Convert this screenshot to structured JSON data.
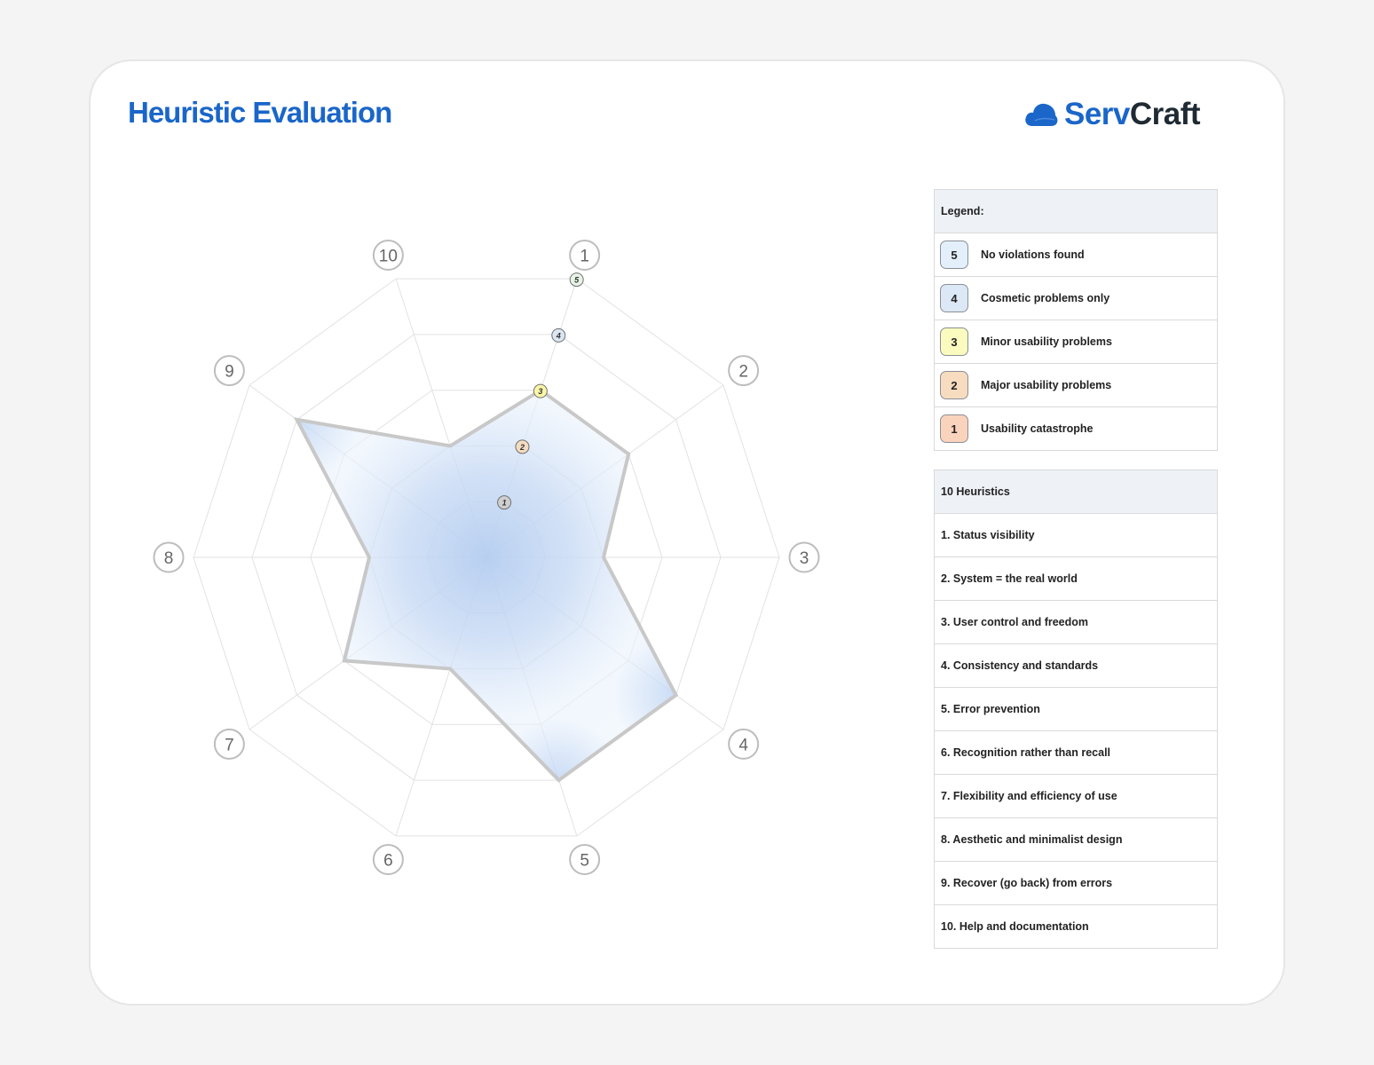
{
  "header": {
    "title": "Heuristic Evaluation",
    "brand_part1": "Serv",
    "brand_part2": "Craft",
    "brand_colors": {
      "accent": "#1a66c9",
      "dark": "#1f2a33"
    }
  },
  "legend": {
    "title": "Legend:",
    "items": [
      {
        "value": "5",
        "label": "No violations found",
        "color": "#e3f0fb"
      },
      {
        "value": "4",
        "label": "Cosmetic problems only",
        "color": "#dde8f6"
      },
      {
        "value": "3",
        "label": "Minor usability problems",
        "color": "#fbfbbf"
      },
      {
        "value": "2",
        "label": "Major usability problems",
        "color": "#f7dcc0"
      },
      {
        "value": "1",
        "label": "Usability catastrophe",
        "color": "#fad3bd"
      }
    ]
  },
  "heuristics": {
    "title": "10 Heuristics",
    "items": [
      "1. Status visibility",
      "2. System = the real world",
      "3. User control and freedom",
      "4. Consistency and standards",
      "5. Error prevention",
      "6. Recognition rather than recall",
      "7. Flexibility and efficiency of use",
      "8. Aesthetic and minimalist design",
      "9. Recover (go back) from errors",
      "10. Help and documentation"
    ]
  },
  "chart_data": {
    "type": "radar",
    "categories": [
      "1",
      "2",
      "3",
      "4",
      "5",
      "6",
      "7",
      "8",
      "9",
      "10"
    ],
    "scale_labels": [
      "1",
      "2",
      "3",
      "4",
      "5"
    ],
    "scale_colors": [
      "#cfcfcf",
      "#f3dcc0",
      "#fbf6a8",
      "#dbe6f3",
      "#e6f3e6"
    ],
    "rlim": [
      0,
      5
    ],
    "series": [
      {
        "values": [
          3,
          3,
          2,
          4,
          4,
          2,
          3,
          2,
          4,
          2
        ]
      }
    ],
    "colors": {
      "fill": "#eaf2fc",
      "fill_center": "#b4cdf0",
      "stroke": "#c8c8c8",
      "grid": "#e2e2e2"
    },
    "grid": true
  }
}
